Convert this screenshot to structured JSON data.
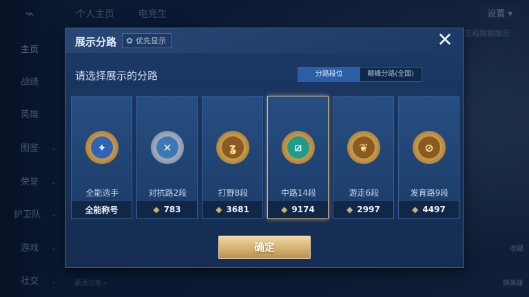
{
  "background": {
    "back_icon": "back-arrow-icon",
    "nav_items": [
      {
        "label": "主页",
        "active": true
      },
      {
        "label": "战绩"
      },
      {
        "label": "英雄"
      },
      {
        "label": "图鉴",
        "chevron": true,
        "dot": true
      },
      {
        "label": "荣誉",
        "chevron": true,
        "dot": true
      },
      {
        "label": "护卫队",
        "chevron": true
      },
      {
        "label": "游戏",
        "chevron": true
      },
      {
        "label": "社交",
        "chevron": true,
        "dot": true
      }
    ],
    "top_tabs": [
      "个人主页",
      "电竞生"
    ],
    "settings_label": "设置",
    "right_note": "宝和数据展示",
    "bottom_note": "最近访客>",
    "right_labels": [
      "收藏",
      "换英雄"
    ]
  },
  "modal": {
    "title": "展示分路",
    "priority_button": {
      "icon": "gear-icon",
      "label": "优先显示"
    },
    "close_icon": "close-icon",
    "prompt": "请选择展示的分路",
    "segment": {
      "options": [
        "分路段位",
        "巅峰分路(全国)"
      ],
      "selected_index": 0
    },
    "cards": [
      {
        "name": "全能选手",
        "value": "全能称号",
        "badge_icon": "all-round-badge-icon",
        "show_diamond": false,
        "badge_color": "#c99a3f",
        "inner_color": "#2f63b8",
        "glyph": "✦"
      },
      {
        "name": "对抗路2段",
        "value": "783",
        "badge_icon": "clash-lane-badge-icon",
        "show_diamond": true,
        "badge_color": "#9aa6b8",
        "inner_color": "#3b78b5",
        "glyph": "✕"
      },
      {
        "name": "打野8段",
        "value": "3681",
        "badge_icon": "jungle-badge-icon",
        "show_diamond": true,
        "badge_color": "#c99a3f",
        "inner_color": "#8a5a1e",
        "glyph": "ʓ"
      },
      {
        "name": "中路14段",
        "value": "9174",
        "badge_icon": "mid-lane-badge-icon",
        "show_diamond": true,
        "badge_color": "#c99a3f",
        "inner_color": "#1f9b8a",
        "glyph": "⧄"
      },
      {
        "name": "游走6段",
        "value": "2997",
        "badge_icon": "roam-badge-icon",
        "show_diamond": true,
        "badge_color": "#c99a3f",
        "inner_color": "#8a5a1e",
        "glyph": "❦"
      },
      {
        "name": "发育路9段",
        "value": "4497",
        "badge_icon": "farm-lane-badge-icon",
        "show_diamond": true,
        "badge_color": "#c99a3f",
        "inner_color": "#8a5a1e",
        "glyph": "⊘"
      }
    ],
    "selected_card_index": 3,
    "confirm_label": "确定"
  }
}
